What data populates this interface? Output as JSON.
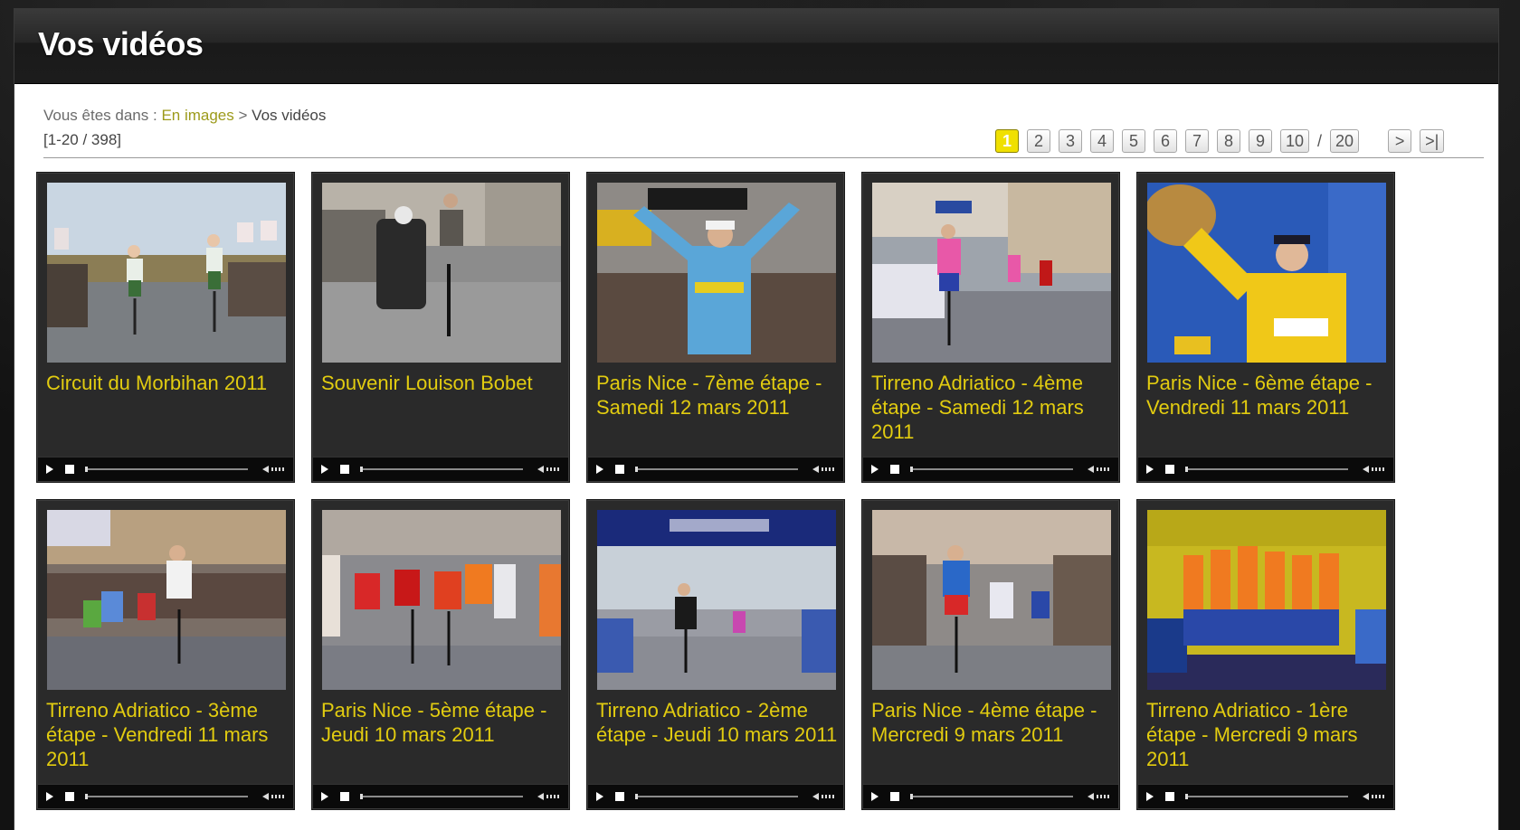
{
  "page": {
    "title": "Vos vidéos"
  },
  "breadcrumb": {
    "prefix": "Vous êtes dans :",
    "link": "En images",
    "separator": ">",
    "current": "Vos vidéos"
  },
  "results": {
    "range": "[1-20 / 398]"
  },
  "pagination": {
    "pages": [
      "1",
      "2",
      "3",
      "4",
      "5",
      "6",
      "7",
      "8",
      "9",
      "10"
    ],
    "active": "1",
    "separator": "/",
    "total": "20",
    "next_label": ">",
    "last_label": ">|"
  },
  "colors": {
    "accent_yellow": "#e2cc10",
    "active_page": "#f0e000",
    "header_dark": "#1c1c1c",
    "card_bg": "#2a2a2a"
  },
  "videos": [
    {
      "title": "Circuit du Morbihan 2011"
    },
    {
      "title": "Souvenir Louison Bobet"
    },
    {
      "title": "Paris Nice - 7ème étape - Samedi 12 mars 2011"
    },
    {
      "title": "Tirreno Adriatico - 4ème étape - Samedi 12 mars 2011"
    },
    {
      "title": "Paris Nice - 6ème étape - Vendredi 11 mars 2011"
    },
    {
      "title": "Tirreno Adriatico - 3ème étape - Vendredi 11 mars 2011"
    },
    {
      "title": "Paris Nice - 5ème étape - Jeudi 10 mars 2011"
    },
    {
      "title": "Tirreno Adriatico - 2ème étape - Jeudi 10 mars 2011"
    },
    {
      "title": "Paris Nice - 4ème étape - Mercredi 9 mars 2011"
    },
    {
      "title": "Tirreno Adriatico - 1ère étape - Mercredi 9 mars 2011"
    }
  ],
  "player": {
    "play_icon": "play-icon",
    "stop_icon": "stop-icon",
    "volume_icon": "volume-icon"
  }
}
